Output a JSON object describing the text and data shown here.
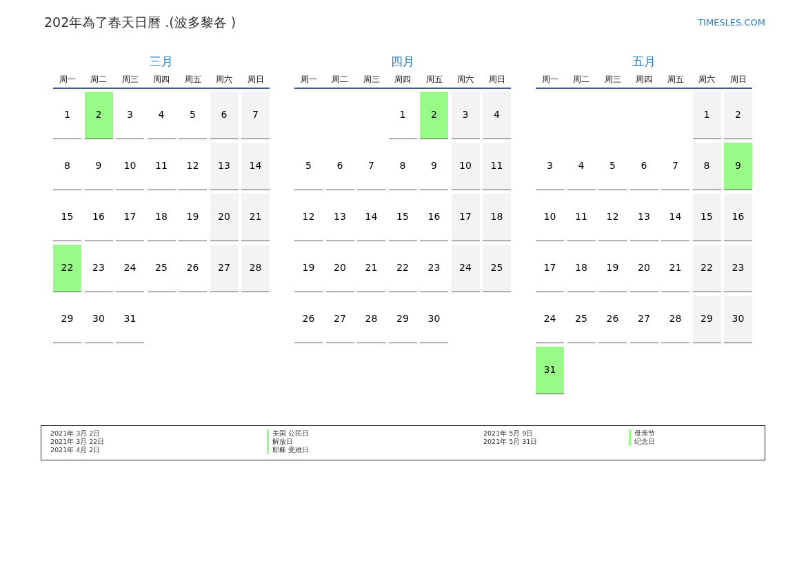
{
  "title": "202年為了春天日曆 .(波多黎各 )",
  "site": "TIMESLES.COM",
  "months": [
    {
      "name": "三月",
      "weekdays": [
        "周一",
        "周二",
        "周三",
        "周四",
        "周五",
        "周六",
        "周日"
      ],
      "weeks": [
        [
          {
            "kind": "day",
            "day": "1",
            "weekend": false
          },
          {
            "kind": "day",
            "day": "2",
            "holiday": true
          },
          {
            "kind": "day",
            "day": "3",
            "weekend": false
          },
          {
            "kind": "day",
            "day": "4",
            "weekend": false
          },
          {
            "kind": "day",
            "day": "5",
            "weekend": false
          },
          {
            "kind": "day",
            "day": "6",
            "weekend": true
          },
          {
            "kind": "day",
            "day": "7",
            "weekend": true
          }
        ],
        [
          {
            "kind": "day",
            "day": "8",
            "weekend": false
          },
          {
            "kind": "day",
            "day": "9",
            "weekend": false
          },
          {
            "kind": "day",
            "day": "10",
            "weekend": false
          },
          {
            "kind": "day",
            "day": "11",
            "weekend": false
          },
          {
            "kind": "day",
            "day": "12",
            "weekend": false
          },
          {
            "kind": "day",
            "day": "13",
            "weekend": true
          },
          {
            "kind": "day",
            "day": "14",
            "weekend": true
          }
        ],
        [
          {
            "kind": "day",
            "day": "15",
            "weekend": false
          },
          {
            "kind": "day",
            "day": "16",
            "weekend": false
          },
          {
            "kind": "day",
            "day": "17",
            "weekend": false
          },
          {
            "kind": "day",
            "day": "18",
            "weekend": false
          },
          {
            "kind": "day",
            "day": "19",
            "weekend": false
          },
          {
            "kind": "day",
            "day": "20",
            "weekend": true
          },
          {
            "kind": "day",
            "day": "21",
            "weekend": true
          }
        ],
        [
          {
            "kind": "day",
            "day": "22",
            "holiday": true
          },
          {
            "kind": "day",
            "day": "23",
            "weekend": false
          },
          {
            "kind": "day",
            "day": "24",
            "weekend": false
          },
          {
            "kind": "day",
            "day": "25",
            "weekend": false
          },
          {
            "kind": "day",
            "day": "26",
            "weekend": false
          },
          {
            "kind": "day",
            "day": "27",
            "weekend": true
          },
          {
            "kind": "day",
            "day": "28",
            "weekend": true
          }
        ],
        [
          {
            "kind": "day",
            "day": "29",
            "weekend": false
          },
          {
            "kind": "day",
            "day": "30",
            "weekend": false
          },
          {
            "kind": "day",
            "day": "31",
            "weekend": false
          }
        ]
      ]
    },
    {
      "name": "四月",
      "weekdays": [
        "周一",
        "周二",
        "周三",
        "周四",
        "周五",
        "周六",
        "周日"
      ],
      "weeks": [
        [
          {
            "kind": "blank"
          },
          {
            "kind": "blank"
          },
          {
            "kind": "blank"
          },
          {
            "kind": "day",
            "day": "1",
            "weekend": false
          },
          {
            "kind": "day",
            "day": "2",
            "holiday": true
          },
          {
            "kind": "day",
            "day": "3",
            "weekend": true
          },
          {
            "kind": "day",
            "day": "4",
            "weekend": true
          }
        ],
        [
          {
            "kind": "day",
            "day": "5",
            "weekend": false
          },
          {
            "kind": "day",
            "day": "6",
            "weekend": false
          },
          {
            "kind": "day",
            "day": "7",
            "weekend": false
          },
          {
            "kind": "day",
            "day": "8",
            "weekend": false
          },
          {
            "kind": "day",
            "day": "9",
            "weekend": false
          },
          {
            "kind": "day",
            "day": "10",
            "weekend": true
          },
          {
            "kind": "day",
            "day": "11",
            "weekend": true
          }
        ],
        [
          {
            "kind": "day",
            "day": "12",
            "weekend": false
          },
          {
            "kind": "day",
            "day": "13",
            "weekend": false
          },
          {
            "kind": "day",
            "day": "14",
            "weekend": false
          },
          {
            "kind": "day",
            "day": "15",
            "weekend": false
          },
          {
            "kind": "day",
            "day": "16",
            "weekend": false
          },
          {
            "kind": "day",
            "day": "17",
            "weekend": true
          },
          {
            "kind": "day",
            "day": "18",
            "weekend": true
          }
        ],
        [
          {
            "kind": "day",
            "day": "19",
            "weekend": false
          },
          {
            "kind": "day",
            "day": "20",
            "weekend": false
          },
          {
            "kind": "day",
            "day": "21",
            "weekend": false
          },
          {
            "kind": "day",
            "day": "22",
            "weekend": false
          },
          {
            "kind": "day",
            "day": "23",
            "weekend": false
          },
          {
            "kind": "day",
            "day": "24",
            "weekend": true
          },
          {
            "kind": "day",
            "day": "25",
            "weekend": true
          }
        ],
        [
          {
            "kind": "day",
            "day": "26",
            "weekend": false
          },
          {
            "kind": "day",
            "day": "27",
            "weekend": false
          },
          {
            "kind": "day",
            "day": "28",
            "weekend": false
          },
          {
            "kind": "day",
            "day": "29",
            "weekend": false
          },
          {
            "kind": "day",
            "day": "30",
            "weekend": false
          }
        ]
      ]
    },
    {
      "name": "五月",
      "weekdays": [
        "周一",
        "周二",
        "周三",
        "周四",
        "周五",
        "周六",
        "周日"
      ],
      "weeks": [
        [
          {
            "kind": "blank"
          },
          {
            "kind": "blank"
          },
          {
            "kind": "blank"
          },
          {
            "kind": "blank"
          },
          {
            "kind": "blank"
          },
          {
            "kind": "day",
            "day": "1",
            "weekend": true
          },
          {
            "kind": "day",
            "day": "2",
            "weekend": true
          }
        ],
        [
          {
            "kind": "day",
            "day": "3",
            "weekend": false
          },
          {
            "kind": "day",
            "day": "4",
            "weekend": false
          },
          {
            "kind": "day",
            "day": "5",
            "weekend": false
          },
          {
            "kind": "day",
            "day": "6",
            "weekend": false
          },
          {
            "kind": "day",
            "day": "7",
            "weekend": false
          },
          {
            "kind": "day",
            "day": "8",
            "weekend": true
          },
          {
            "kind": "day",
            "day": "9",
            "holiday": true
          }
        ],
        [
          {
            "kind": "day",
            "day": "10",
            "weekend": false
          },
          {
            "kind": "day",
            "day": "11",
            "weekend": false
          },
          {
            "kind": "day",
            "day": "12",
            "weekend": false
          },
          {
            "kind": "day",
            "day": "13",
            "weekend": false
          },
          {
            "kind": "day",
            "day": "14",
            "weekend": false
          },
          {
            "kind": "day",
            "day": "15",
            "weekend": true
          },
          {
            "kind": "day",
            "day": "16",
            "weekend": true
          }
        ],
        [
          {
            "kind": "day",
            "day": "17",
            "weekend": false
          },
          {
            "kind": "day",
            "day": "18",
            "weekend": false
          },
          {
            "kind": "day",
            "day": "19",
            "weekend": false
          },
          {
            "kind": "day",
            "day": "20",
            "weekend": false
          },
          {
            "kind": "day",
            "day": "21",
            "weekend": false
          },
          {
            "kind": "day",
            "day": "22",
            "weekend": true
          },
          {
            "kind": "day",
            "day": "23",
            "weekend": true
          }
        ],
        [
          {
            "kind": "day",
            "day": "24",
            "weekend": false
          },
          {
            "kind": "day",
            "day": "25",
            "weekend": false
          },
          {
            "kind": "day",
            "day": "26",
            "weekend": false
          },
          {
            "kind": "day",
            "day": "27",
            "weekend": false
          },
          {
            "kind": "day",
            "day": "28",
            "weekend": false
          },
          {
            "kind": "day",
            "day": "29",
            "weekend": true
          },
          {
            "kind": "day",
            "day": "30",
            "weekend": true
          }
        ],
        [
          {
            "kind": "day",
            "day": "31",
            "holiday": true
          }
        ]
      ]
    }
  ],
  "legend": [
    [
      {
        "date": "2021年 3月 2日",
        "holiday": "美国 公民日"
      },
      {
        "date": "2021年 3月 22日",
        "holiday": "解放日"
      },
      {
        "date": "2021年 4月 2日",
        "holiday": "耶稣 受难日"
      }
    ],
    [
      {
        "date": "2021年 5月 9日",
        "holiday": "母亲节"
      },
      {
        "date": "2021年 5月 31日",
        "holiday": "纪念日"
      }
    ]
  ]
}
